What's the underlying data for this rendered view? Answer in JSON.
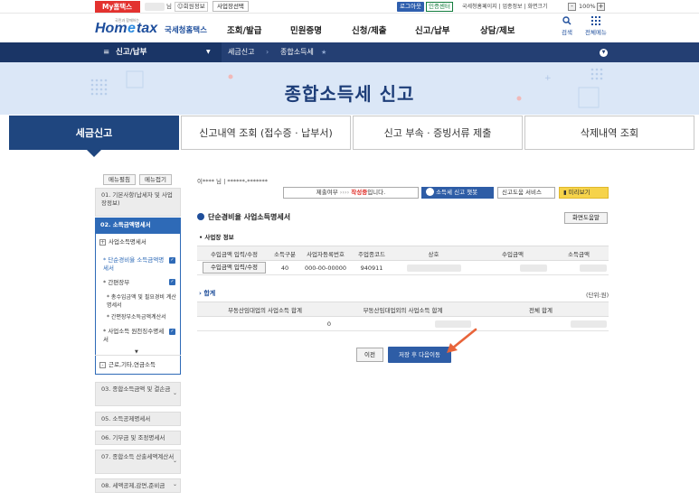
{
  "topbar": {
    "my_hometax": "My홈택스",
    "user_suffix": "님",
    "member_info": "회원정보",
    "business_select": "사업장선택",
    "logout": "로그아웃",
    "cert_center": "인증센터",
    "links": "국세청홈페이지 | 업종정보 | 화면크기",
    "zoom": "100%"
  },
  "header": {
    "logo_text": "Hometax",
    "logo_sub": "국세청홈택스",
    "nav": [
      "조회/발급",
      "민원증명",
      "신청/제출",
      "신고/납부",
      "상담/제보"
    ],
    "search": "검색",
    "all_menu": "전체메뉴"
  },
  "breadcrumb": {
    "root": "신고/납부",
    "level1": "세금신고",
    "level2": "종합소득세"
  },
  "banner": {
    "title": "종합소득세 신고"
  },
  "tabs": [
    "세금신고",
    "신고내역 조회 (접수증 · 납부서)",
    "신고 부속 · 증빙서류 제출",
    "삭제내역 조회"
  ],
  "sidebar": {
    "edit_menu": "메뉴펼침",
    "collapse_menu": "메뉴접기",
    "items": [
      "01. 기본사항(납세자 및 사업장정보)",
      "02. 소득금액명세서",
      "03. 종합소득금액 및 결손금",
      "05. 소득공제명세서",
      "06. 기부금 및 조정명세서",
      "07. 종합소득 산출세액계산서",
      "08. 세액공제,감면,준비금"
    ],
    "sub": {
      "business_income": "사업소득명세서",
      "simple_expense": "단순경비율 소득금액명세서",
      "simple_book": "간편장부",
      "total_income_expense": "총수입금액 및 필요경비 계산명세서",
      "simple_book_income": "간편장부소득금액계산서",
      "withholding": "사업소득 원천징수명세서",
      "other_income": "근로,기타,연금소득"
    }
  },
  "content": {
    "user_line": "이**** 님 | ******-*******",
    "submit_label": "제출여부",
    "submit_status_prefix": "›››› ",
    "submit_status": "작성중",
    "submit_status_suffix": "입니다.",
    "chatbot": "소득세 신고 챗봇",
    "help_service": "신고도움 서비스",
    "preview": "미리보기",
    "help_btn": "화면도움말",
    "section_title": "단순경비율 사업소득명세서",
    "business_info": "사업장 정보",
    "table1": {
      "headers": [
        "수입금액 입력/수정",
        "소득구분",
        "사업자등록번호",
        "주업종코드",
        "상호",
        "수입금액",
        "소득금액"
      ],
      "row": {
        "button": "수입금액 입력/수정",
        "type": "40",
        "reg_no": "000-00-00000",
        "code": "940911"
      }
    },
    "total_label": "합계",
    "unit": "(단위:원)",
    "table2": {
      "headers": [
        "부동산임대업의 사업소득 합계",
        "부동산임대업외의 사업소득 합계",
        "전체 합계"
      ],
      "row": [
        "0",
        "",
        ""
      ]
    },
    "prev_btn": "이전",
    "next_btn": "저장 후 다음이동"
  }
}
